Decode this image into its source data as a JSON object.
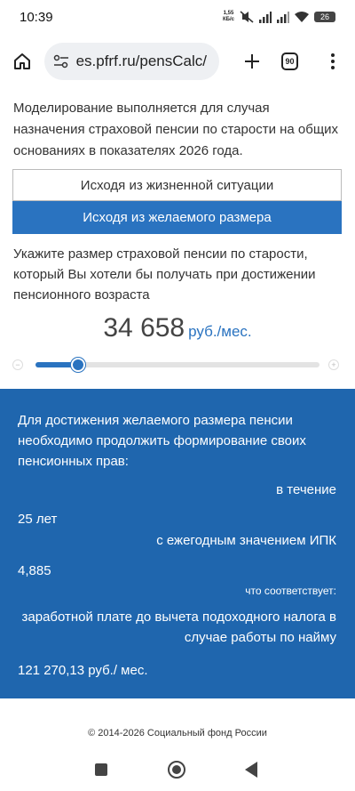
{
  "status_bar": {
    "time": "10:39",
    "net_speed_value": "1,55",
    "net_speed_unit": "КБ/с",
    "battery": "26",
    "icons": [
      "mute-icon",
      "signal-icon",
      "signal-icon",
      "wifi-icon",
      "battery-icon"
    ]
  },
  "browser": {
    "url": "es.pfrf.ru/pensCalc/",
    "tab_count": "90",
    "icons": [
      "home-icon",
      "site-settings-icon",
      "plus-icon",
      "tabs-icon",
      "menu-icon"
    ]
  },
  "main": {
    "intro": "Моделирование выполняется для случая назначения страховой пенсии по старости на общих основаниях в показателях 2026 года.",
    "option_life": "Исходя из жизненной ситуации",
    "option_desired": "Исходя из желаемого размера",
    "prompt": "Укажите размер страховой пенсии по старости, который Вы хотели бы получать при достижении пенсионного возраста",
    "amount": "34 658",
    "amount_unit": "руб./мес.",
    "slider_minus": "−",
    "slider_plus": "+",
    "slider_level": 0.15
  },
  "result": {
    "intro": "Для достижения желаемого размера пенсии необходимо продолжить формирование своих пенсионных прав:",
    "during_label": "в течение",
    "years": "25 лет",
    "ipk_label": "с ежегодным значением ИПК",
    "ipk_value": "4,885",
    "corresponds_label": "что соответствует:",
    "salary_label": "заработной плате до вычета подоходного налога в случае работы по найму",
    "salary_value": "121 270,13 руб./ мес."
  },
  "footer": {
    "copyright": "© 2014-2026 Социальный фонд России"
  },
  "colors": {
    "accent": "#2a73c0",
    "result_bg": "#1f66ae"
  }
}
